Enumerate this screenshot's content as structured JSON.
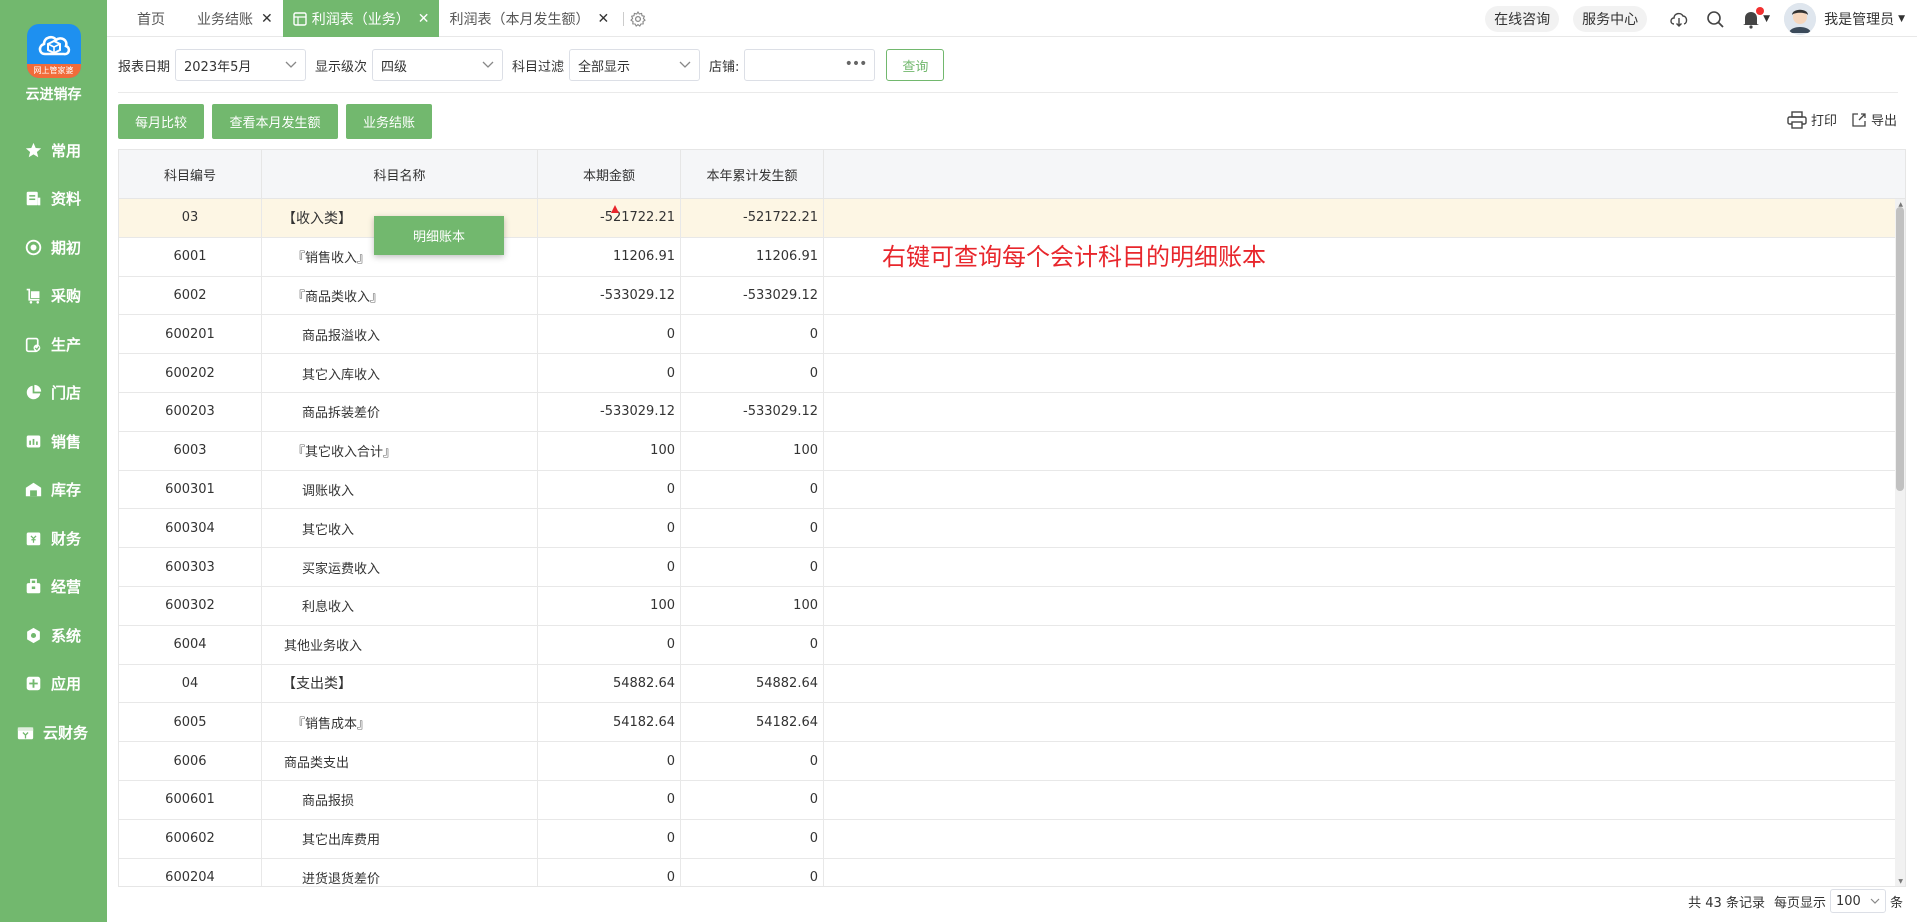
{
  "app": {
    "name": "云进销存",
    "logo_tag": "网上管家婆",
    "colors": {
      "primary": "#72b86e",
      "accent": "#1e90f0",
      "annotation": "#e8262c",
      "highlight_row": "#fdf6e4"
    }
  },
  "sidebar": {
    "items": [
      {
        "label": "常用",
        "icon": "star-icon"
      },
      {
        "label": "资料",
        "icon": "document-icon"
      },
      {
        "label": "期初",
        "icon": "target-icon"
      },
      {
        "label": "采购",
        "icon": "cart-icon"
      },
      {
        "label": "生产",
        "icon": "production-icon"
      },
      {
        "label": "门店",
        "icon": "pie-icon"
      },
      {
        "label": "销售",
        "icon": "sales-icon"
      },
      {
        "label": "库存",
        "icon": "warehouse-icon"
      },
      {
        "label": "财务",
        "icon": "finance-icon"
      },
      {
        "label": "经营",
        "icon": "business-icon"
      },
      {
        "label": "系统",
        "icon": "settings-icon"
      },
      {
        "label": "应用",
        "icon": "plus-icon"
      },
      {
        "label": "云财务",
        "icon": "cloud-finance-icon"
      }
    ]
  },
  "tabs": [
    {
      "label": "首页"
    },
    {
      "label": "业务结账"
    },
    {
      "label": "利润表（业务）"
    },
    {
      "label": "利润表（本月发生额）"
    }
  ],
  "topbar": {
    "consult": "在线咨询",
    "service": "服务中心",
    "username": "我是管理员"
  },
  "filters": {
    "date_label": "报表日期",
    "date_value": "2023年5月",
    "level_label": "显示级次",
    "level_value": "四级",
    "subject_label": "科目过滤",
    "subject_value": "全部显示",
    "shop_label": "店铺:",
    "shop_value": "",
    "query_button": "查询"
  },
  "actions": {
    "monthly_compare": "每月比较",
    "view_month": "查看本月发生额",
    "business_close": "业务结账",
    "print": "打印",
    "export": "导出"
  },
  "table": {
    "headers": [
      "科目编号",
      "科目名称",
      "本期金额",
      "本年累计发生额"
    ],
    "rows": [
      {
        "code": "03",
        "name": "【收入类】",
        "current": "-521722.21",
        "ytd": "-521722.21"
      },
      {
        "code": "6001",
        "name": "『销售收入』",
        "current": "11206.91",
        "ytd": "11206.91"
      },
      {
        "code": "6002",
        "name": "『商品类收入』",
        "current": "-533029.12",
        "ytd": "-533029.12"
      },
      {
        "code": "600201",
        "name": "商品报溢收入",
        "current": "0",
        "ytd": "0"
      },
      {
        "code": "600202",
        "name": "其它入库收入",
        "current": "0",
        "ytd": "0"
      },
      {
        "code": "600203",
        "name": "商品拆装差价",
        "current": "-533029.12",
        "ytd": "-533029.12"
      },
      {
        "code": "6003",
        "name": "『其它收入合计』",
        "current": "100",
        "ytd": "100"
      },
      {
        "code": "600301",
        "name": "调账收入",
        "current": "0",
        "ytd": "0"
      },
      {
        "code": "600304",
        "name": "其它收入",
        "current": "0",
        "ytd": "0"
      },
      {
        "code": "600303",
        "name": "买家运费收入",
        "current": "0",
        "ytd": "0"
      },
      {
        "code": "600302",
        "name": "利息收入",
        "current": "100",
        "ytd": "100"
      },
      {
        "code": "6004",
        "name": "其他业务收入",
        "current": "0",
        "ytd": "0"
      },
      {
        "code": "04",
        "name": "【支出类】",
        "current": "54882.64",
        "ytd": "54882.64"
      },
      {
        "code": "6005",
        "name": "『销售成本』",
        "current": "54182.64",
        "ytd": "54182.64"
      },
      {
        "code": "6006",
        "name": "商品类支出",
        "current": "0",
        "ytd": "0"
      },
      {
        "code": "600601",
        "name": "商品报损",
        "current": "0",
        "ytd": "0"
      },
      {
        "code": "600602",
        "name": "其它出库费用",
        "current": "0",
        "ytd": "0"
      },
      {
        "code": "600204",
        "name": "进货退货差价",
        "current": "0",
        "ytd": "0"
      }
    ]
  },
  "context_menu": {
    "item": "明细账本"
  },
  "annotation": "右键可查询每个会计科目的明细账本",
  "footer": {
    "total": "共 43 条记录",
    "per_page_label": "每页显示",
    "per_page_value": "100",
    "unit": "条"
  }
}
